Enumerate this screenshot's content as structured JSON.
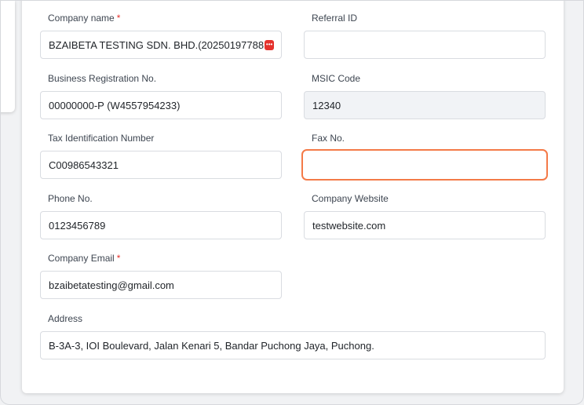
{
  "form": {
    "company_name": {
      "label": "Company name",
      "required_mark": "*",
      "value": "BZAIBETA TESTING SDN. BHD.(20250197788"
    },
    "referral_id": {
      "label": "Referral ID",
      "value": ""
    },
    "business_registration": {
      "label": "Business Registration No.",
      "value": "00000000-P (W4557954233)"
    },
    "msic_code": {
      "label": "MSIC Code",
      "value": "12340"
    },
    "tax_id": {
      "label": "Tax Identification Number",
      "value": "C00986543321"
    },
    "fax_no": {
      "label": "Fax No.",
      "value": ""
    },
    "phone_no": {
      "label": "Phone No.",
      "value": "0123456789"
    },
    "company_website": {
      "label": "Company Website",
      "value": "testwebsite.com"
    },
    "company_email": {
      "label": "Company Email",
      "required_mark": "*",
      "value": "bzaibetatesting@gmail.com"
    },
    "address": {
      "label": "Address",
      "value": "B-3A-3, IOI Boulevard, Jalan Kenari 5, Bandar Puchong Jaya, Puchong."
    }
  },
  "icons": {
    "overflow_badge": "overflow-dots-icon"
  },
  "colors": {
    "focus_border": "#f47a48",
    "required": "#e5322d",
    "readonly_bg": "#f1f3f6"
  }
}
